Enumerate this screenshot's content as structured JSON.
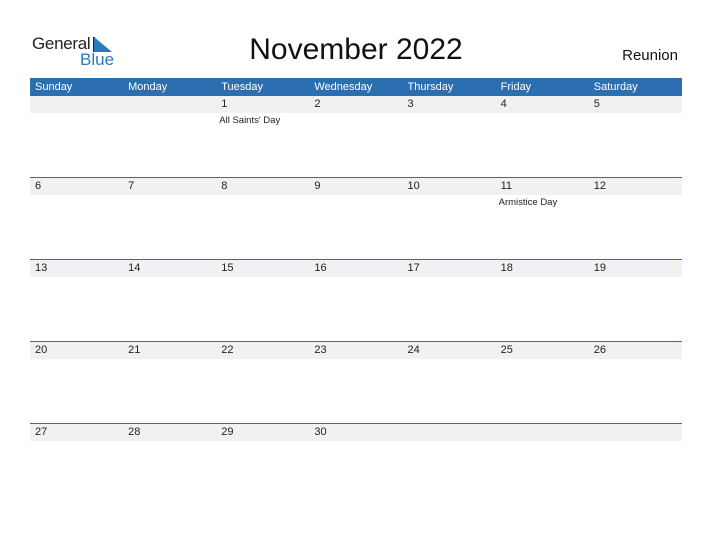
{
  "brand": {
    "line1": "General",
    "line2": "Blue",
    "accent": "#2a7ac0"
  },
  "title": "November 2022",
  "country": "Reunion",
  "header_color": "#2c6fb0",
  "weekdays": [
    "Sunday",
    "Monday",
    "Tuesday",
    "Wednesday",
    "Thursday",
    "Friday",
    "Saturday"
  ],
  "weeks": [
    {
      "days": [
        "",
        "",
        "1",
        "2",
        "3",
        "4",
        "5"
      ],
      "events": [
        "",
        "",
        "All Saints' Day",
        "",
        "",
        "",
        ""
      ]
    },
    {
      "days": [
        "6",
        "7",
        "8",
        "9",
        "10",
        "11",
        "12"
      ],
      "events": [
        "",
        "",
        "",
        "",
        "",
        "Armistice Day",
        ""
      ]
    },
    {
      "days": [
        "13",
        "14",
        "15",
        "16",
        "17",
        "18",
        "19"
      ],
      "events": [
        "",
        "",
        "",
        "",
        "",
        "",
        ""
      ]
    },
    {
      "days": [
        "20",
        "21",
        "22",
        "23",
        "24",
        "25",
        "26"
      ],
      "events": [
        "",
        "",
        "",
        "",
        "",
        "",
        ""
      ]
    },
    {
      "days": [
        "27",
        "28",
        "29",
        "30",
        "",
        "",
        ""
      ],
      "events": [
        "",
        "",
        "",
        "",
        "",
        "",
        ""
      ]
    }
  ]
}
